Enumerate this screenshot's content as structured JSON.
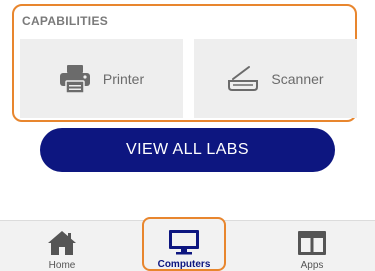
{
  "capabilities": {
    "title": "CAPABILITIES",
    "items": [
      {
        "label": "Printer",
        "icon": "printer-icon"
      },
      {
        "label": "Scanner",
        "icon": "scanner-icon"
      }
    ]
  },
  "view_all_button": {
    "label": "VIEW ALL LABS"
  },
  "tabbar": {
    "tabs": [
      {
        "label": "Home",
        "icon": "home-icon"
      },
      {
        "label": "Computers",
        "icon": "computer-icon",
        "active": true
      },
      {
        "label": "Apps",
        "icon": "apps-icon"
      }
    ]
  },
  "colors": {
    "accent_orange": "#e8862e",
    "primary_navy": "#0d1680",
    "tile_bg": "#eeeeee",
    "icon_gray": "#6b6b6b"
  }
}
